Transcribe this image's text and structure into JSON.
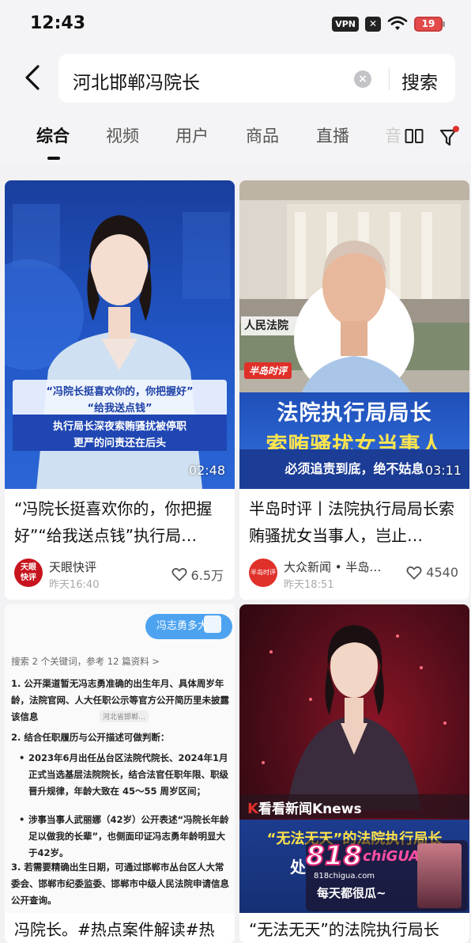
{
  "status_bar": {
    "time": "12:43",
    "vpn": "VPN",
    "x_badge": "✕",
    "battery": "19"
  },
  "search": {
    "query": "河北邯郸冯院长",
    "clear_icon": "×",
    "button": "搜索"
  },
  "tabs": [
    "综合",
    "视频",
    "用户",
    "商品",
    "直播",
    "音"
  ],
  "active_tab": 0,
  "cards": [
    {
      "duration": "02:48",
      "overlay_lines": [
        "“冯院长挺喜欢你的，你把握好”",
        "“给我送点钱”",
        "执行局长深夜索贿骚扰被停职",
        "更严的问责还在后头"
      ],
      "title": "“冯院长挺喜欢你的，你把握好”“给我送点钱”执行局…",
      "author": "天眼快评",
      "avatar_text": "天眼\n快评",
      "time": "昨天16:40",
      "likes": "6.5万"
    },
    {
      "duration": "03:11",
      "building_sign": "人民法院",
      "tag": "半岛时评",
      "banner_line1": "法院执行局局长",
      "banner_line2": "索贿骚扰女当事人",
      "banner_line3": "必须追责到底，绝不姑息",
      "title": "半岛时评丨法院执行局局长索贿骚扰女当事人，岂止…",
      "author": "大众新闻 • 半岛…",
      "avatar_text": "半岛时评",
      "time": "昨天18:51",
      "likes": "4540"
    },
    {
      "chat_bubble": "冯志勇多大",
      "search_meta": "搜索 2 个关键词，参考 12 篇资料 >",
      "items": [
        "1. 公开渠道暂无冯志勇准确的出生年月、具体周岁年龄，法院官网、人大任职公示等官方公开简历里未披露该信息",
        "2. 结合任职履历与公开描述可做判断：",
        "2023年6月出任丛台区法院代院长、2024年1月正式当选基层法院院长，结合法官任职年限、职级晋升规律，年龄大致在 45～55 周岁区间；",
        "涉事当事人武丽娜（42岁）公开表述“冯院长年龄足以做我的长辈”，也侧面印证冯志勇年龄明显大于42岁。",
        "3. 若需要精确出生日期，可通过邯郸市丛台区人大常委会、邯郸市纪委监委、邯郸市中级人民法院申请信息公开查询。"
      ],
      "chip": "河北省邯郸…",
      "title": "冯院长。#热点案件解读#热"
    },
    {
      "logo": "看看新闻Knews",
      "banner": "“无法无天”的法院执行局长",
      "banner_sub": "处",
      "watermark_main": "818",
      "watermark_sub": "chiGUA",
      "watermark_url": "818chigua.com",
      "watermark_slogan": "每天都很瓜~",
      "title": "“无法无天”的法院执行局长"
    }
  ],
  "colors": {
    "accent_red": "#e0302a",
    "news_blue": "#1f4fb8",
    "text": "#111111"
  }
}
